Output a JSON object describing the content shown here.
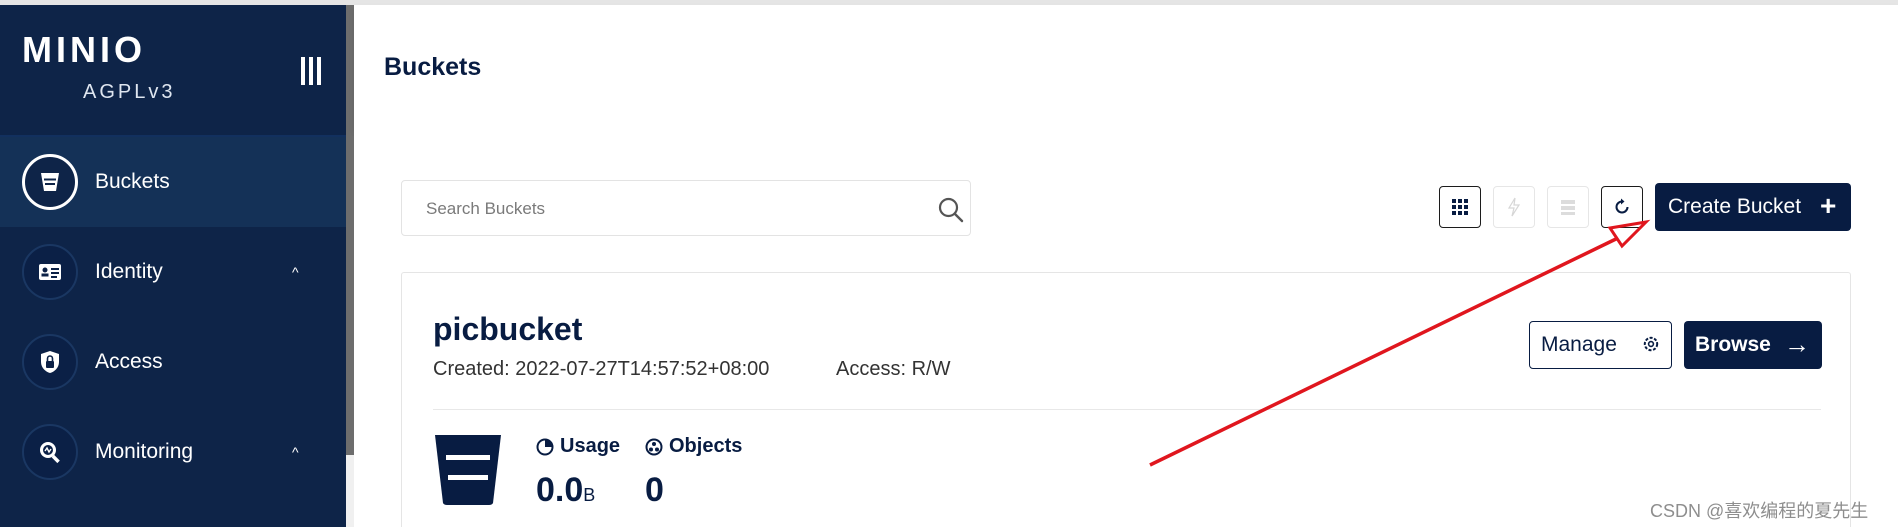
{
  "brand": {
    "logo": "MINIO",
    "edition": "AGPLv3"
  },
  "sidebar": {
    "items": [
      {
        "label": "Buckets",
        "icon": "bucket-icon",
        "active": true,
        "caret": ""
      },
      {
        "label": "Identity",
        "icon": "id-card-icon",
        "active": false,
        "caret": "^"
      },
      {
        "label": "Access",
        "icon": "lock-icon",
        "active": false,
        "caret": ""
      },
      {
        "label": "Monitoring",
        "icon": "monitor-search-icon",
        "active": false,
        "caret": "^"
      }
    ]
  },
  "header": {
    "title": "Buckets"
  },
  "toolbar": {
    "search_placeholder": "Search Buckets",
    "create_label": "Create Bucket",
    "create_plus": "+"
  },
  "bucket": {
    "name": "picbucket",
    "created": "Created: 2022-07-27T14:57:52+08:00",
    "access": "Access: R/W",
    "manage_label": "Manage",
    "browse_label": "Browse",
    "browse_arrow": "→",
    "usage_label": "Usage",
    "usage_value": "0.0",
    "usage_unit": "B",
    "objects_label": "Objects",
    "objects_value": "0"
  },
  "watermark": "CSDN @喜欢编程的夏先生",
  "colors": {
    "sidebar_bg": "#0e2448",
    "primary": "#081c42",
    "annotation": "#e0161e"
  }
}
